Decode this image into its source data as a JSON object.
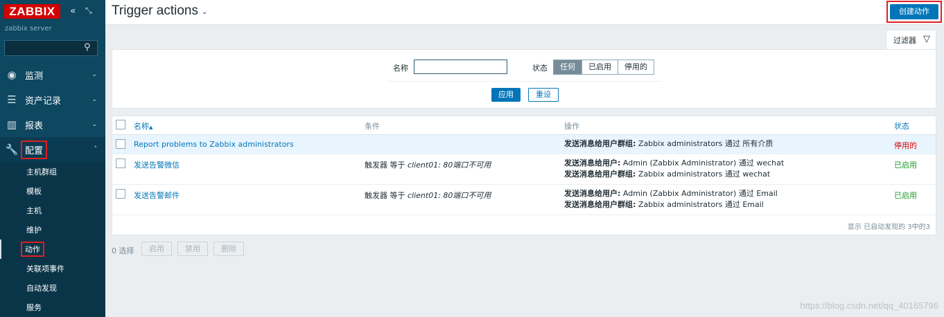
{
  "app": {
    "logo": "ZABBIX",
    "server_name": "zabbix server"
  },
  "sidebar": {
    "search_placeholder": "",
    "menu": [
      {
        "label": "监测",
        "icon": "eye-icon"
      },
      {
        "label": "资产记录",
        "icon": "list-icon"
      },
      {
        "label": "报表",
        "icon": "bar-chart-icon"
      },
      {
        "label": "配置",
        "icon": "wrench-icon"
      }
    ],
    "submenu": [
      "主机群组",
      "模板",
      "主机",
      "维护",
      "动作",
      "关联项事件",
      "自动发现",
      "服务"
    ]
  },
  "header": {
    "title": "Trigger actions",
    "create_label": "创建动作"
  },
  "filter": {
    "tab_label": "过滤器",
    "name_label": "名称",
    "name_value": "",
    "status_label": "状态",
    "status_options": [
      "任何",
      "已启用",
      "停用的"
    ],
    "status_selected": "任何",
    "apply_label": "应用",
    "reset_label": "重设"
  },
  "table": {
    "headers": {
      "name": "名称",
      "sort_arrow": "▲",
      "conditions": "条件",
      "operations": "操作",
      "status": "状态"
    },
    "rows": [
      {
        "name": "Report problems to Zabbix administrators",
        "condition_prefix": "",
        "condition_italic": "",
        "ops": [
          {
            "bold": "发送消息给用户群组:",
            "text": " Zabbix administrators 通过 所有介质"
          }
        ],
        "status": "停用的"
      },
      {
        "name": "发送告警微信",
        "condition_prefix": "触发器 等于 ",
        "condition_italic": "client01: 80端口不可用",
        "ops": [
          {
            "bold": "发送消息给用户:",
            "text": " Admin (Zabbix Administrator) 通过 wechat"
          },
          {
            "bold": "发送消息给用户群组:",
            "text": " Zabbix administrators 通过 wechat"
          }
        ],
        "status": "已启用"
      },
      {
        "name": "发送告警邮件",
        "condition_prefix": "触发器 等于 ",
        "condition_italic": "client01: 80端口不可用",
        "ops": [
          {
            "bold": "发送消息给用户:",
            "text": " Admin (Zabbix Administrator) 通过 Email"
          },
          {
            "bold": "发送消息给用户群组:",
            "text": " Zabbix administrators 通过 Email"
          }
        ],
        "status": "已启用"
      }
    ],
    "count_text": "显示 已自动发现的 3中的3"
  },
  "footer": {
    "selected": "0 选择",
    "enable_label": "启用",
    "disable_label": "禁用",
    "delete_label": "删除"
  },
  "watermark": "https://blog.csdn.net/qq_40165796"
}
